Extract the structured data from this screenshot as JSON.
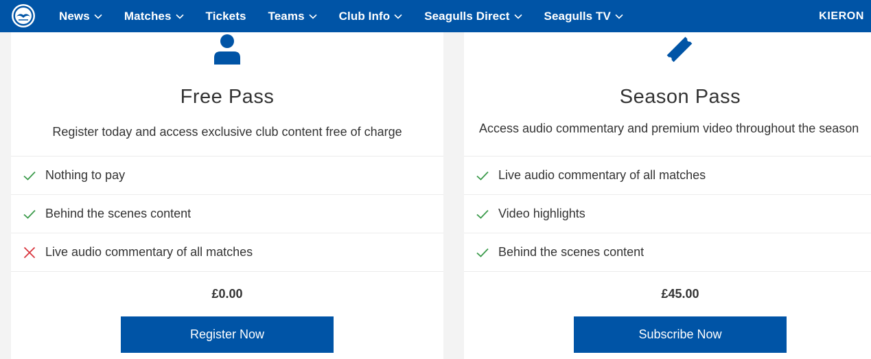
{
  "nav": {
    "logo_icon": "brighton-crest-icon",
    "items": [
      {
        "label": "News",
        "has_dropdown": true
      },
      {
        "label": "Matches",
        "has_dropdown": true
      },
      {
        "label": "Tickets",
        "has_dropdown": false
      },
      {
        "label": "Teams",
        "has_dropdown": true
      },
      {
        "label": "Club Info",
        "has_dropdown": true
      },
      {
        "label": "Seagulls Direct",
        "has_dropdown": true
      },
      {
        "label": "Seagulls TV",
        "has_dropdown": true
      }
    ],
    "user": "KIERON"
  },
  "colors": {
    "brand_blue": "#0054a6",
    "check_green": "#3a9a4a",
    "cross_red": "#d9363e",
    "text": "#333333"
  },
  "cards": [
    {
      "icon": "person-icon",
      "title": "Free Pass",
      "description": "Register today and access exclusive club content free of charge",
      "features": [
        {
          "label": "Nothing to pay",
          "included": true
        },
        {
          "label": "Behind the scenes content",
          "included": true
        },
        {
          "label": "Live audio commentary of all matches",
          "included": false
        }
      ],
      "price": "£0.00",
      "cta": "Register Now"
    },
    {
      "icon": "ticket-icon",
      "title": "Season Pass",
      "description": "Access audio commentary and premium video throughout the season",
      "features": [
        {
          "label": "Live audio commentary of all matches",
          "included": true
        },
        {
          "label": "Video highlights",
          "included": true
        },
        {
          "label": "Behind the scenes content",
          "included": true
        }
      ],
      "price": "£45.00",
      "cta": "Subscribe Now"
    }
  ]
}
